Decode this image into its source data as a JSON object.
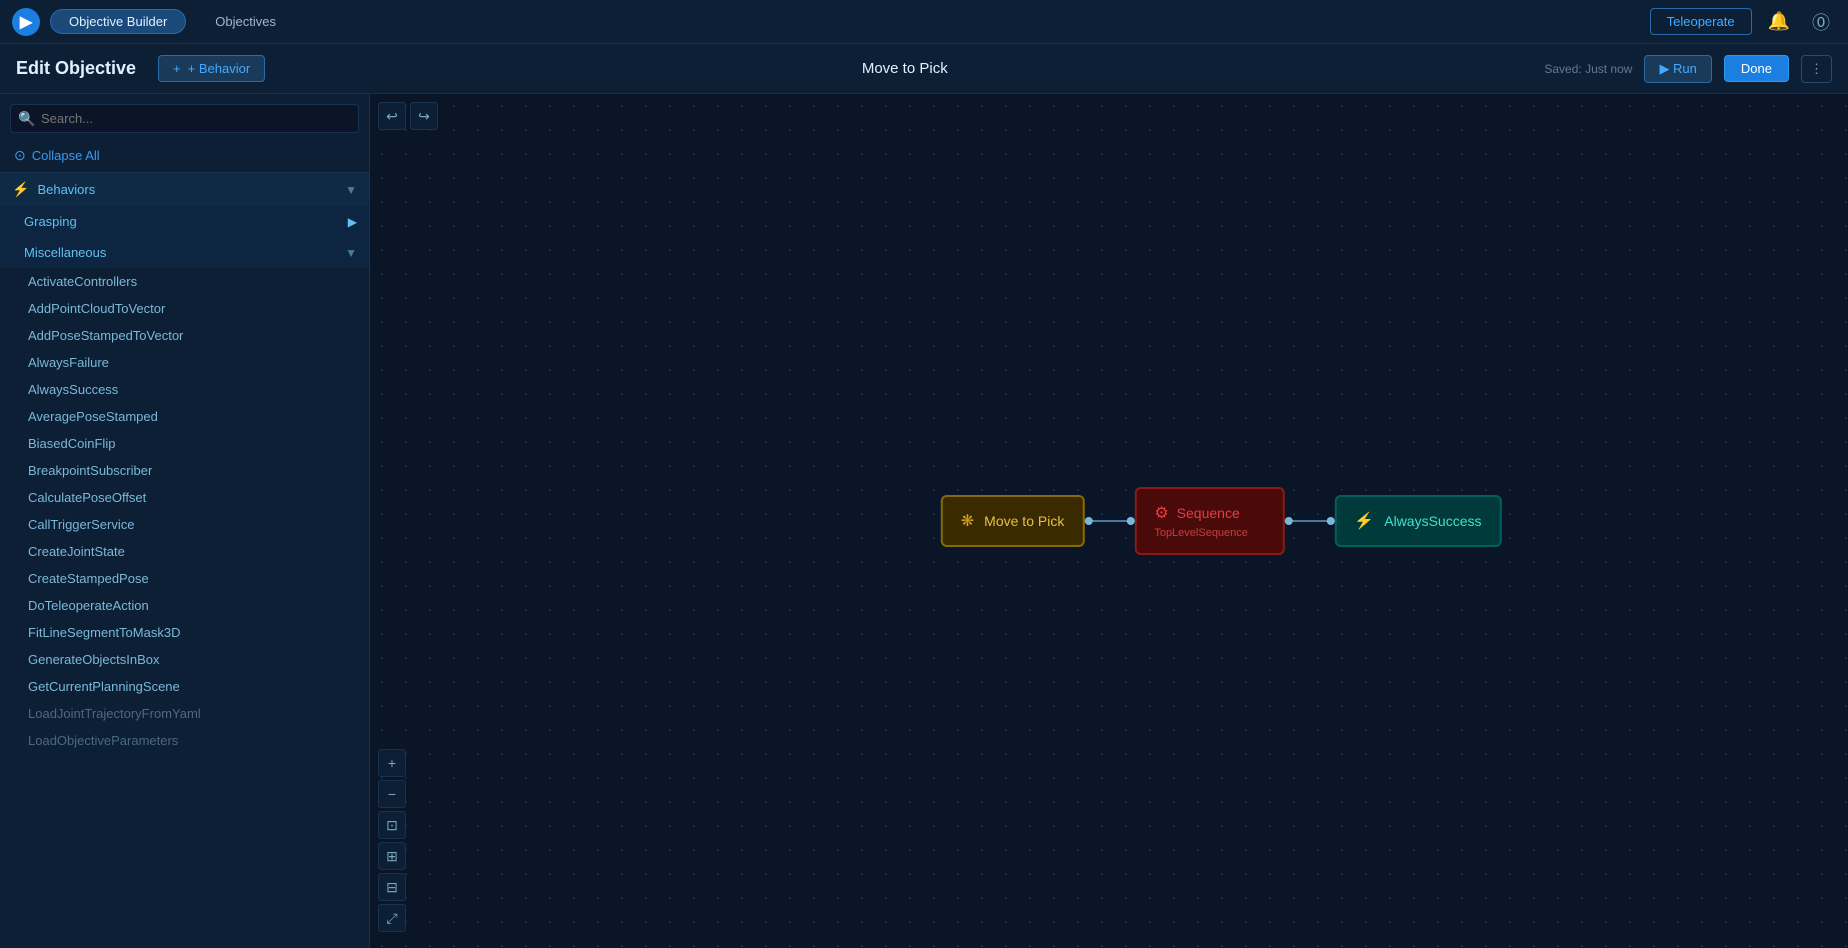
{
  "topbar": {
    "brand_icon": "▶",
    "tabs": [
      {
        "label": "Objective Builder",
        "active": true
      },
      {
        "label": "Objectives",
        "active": false
      }
    ],
    "teleoperate_label": "Teleoperate",
    "notification_icon": "🔔",
    "help_icon": "?"
  },
  "subheader": {
    "edit_objective_label": "Edit Objective",
    "add_behavior_label": "+ Behavior",
    "canvas_title": "Move to Pick",
    "saved_status": "Saved: Just now",
    "run_label": "▶ Run",
    "done_label": "Done",
    "more_label": "⋮"
  },
  "sidebar": {
    "search_placeholder": "Search...",
    "collapse_all_label": "Collapse All",
    "sections": [
      {
        "id": "behaviors",
        "label": "Behaviors",
        "icon": "⚡",
        "expanded": true,
        "subsections": [
          {
            "id": "grasping",
            "label": "Grasping",
            "expanded": false
          },
          {
            "id": "miscellaneous",
            "label": "Miscellaneous",
            "expanded": true,
            "items": [
              "ActivateControllers",
              "AddPointCloudToVector",
              "AddPoseStampedToVector",
              "AlwaysFailure",
              "AlwaysSuccess",
              "AveragePoseStamped",
              "BiasedCoinFlip",
              "BreakpointSubscriber",
              "CalculatePoseOffset",
              "CallTriggerService",
              "CreateJointState",
              "CreateStampedPose",
              "DoTeleoperateAction",
              "FitLineSegmentToMask3D",
              "GenerateObjectsInBox",
              "GetCurrentPlanningScene",
              "LoadJointTrajectoryFromYaml",
              "LoadObjectiveParameters"
            ]
          }
        ]
      }
    ]
  },
  "canvas_toolbar": {
    "undo_icon": "↩",
    "redo_icon": "↪"
  },
  "zoom_controls": {
    "zoom_in_icon": "+",
    "zoom_out_icon": "−",
    "fit_all_icon": "⊡",
    "fit_selection_icon": "⊞",
    "expand_icon": "⊟",
    "fullscreen_icon": "⤢"
  },
  "behavior_tree": {
    "nodes": [
      {
        "id": "root",
        "type": "root",
        "icon": "❋",
        "title": "Move to Pick"
      },
      {
        "id": "sequence",
        "type": "sequence",
        "icon": "⚙",
        "title": "Sequence",
        "subtitle": "TopLevelSequence"
      },
      {
        "id": "always-success",
        "type": "action",
        "icon": "⚡",
        "title": "AlwaysSuccess"
      }
    ]
  }
}
